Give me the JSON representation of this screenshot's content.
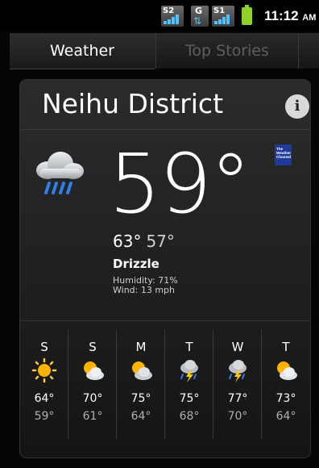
{
  "status_bar": {
    "sim1_label": "S2",
    "sim2_label": "S1",
    "data_label": "G",
    "time": "11:12",
    "ampm": "AM",
    "battery_color": "#8fd12a",
    "signal_color": "#4cc3ff"
  },
  "tabs": [
    {
      "label": "Weather",
      "active": true
    },
    {
      "label": "Top Stories",
      "active": false
    }
  ],
  "weather": {
    "city": "Neihu District",
    "info_icon": "info-icon",
    "current_icon": "rain-cloud-icon",
    "temperature": "59°",
    "provider_logo": "The Weather Channel",
    "high": "63°",
    "low": "57°",
    "condition": "Drizzle",
    "humidity": "Humidity: 71%",
    "wind": "Wind: 13 mph"
  },
  "forecast": [
    {
      "day": "S",
      "icon": "sunny-icon",
      "high": "64°",
      "low": "59°"
    },
    {
      "day": "S",
      "icon": "partly-cloudy-icon",
      "high": "70°",
      "low": "61°"
    },
    {
      "day": "M",
      "icon": "partly-cloudy-icon",
      "high": "75°",
      "low": "64°"
    },
    {
      "day": "T",
      "icon": "thunderstorm-icon",
      "high": "75°",
      "low": "68°"
    },
    {
      "day": "W",
      "icon": "thunderstorm-icon",
      "high": "77°",
      "low": "70°"
    },
    {
      "day": "T",
      "icon": "partly-cloudy-icon",
      "high": "73°",
      "low": "64°"
    }
  ]
}
